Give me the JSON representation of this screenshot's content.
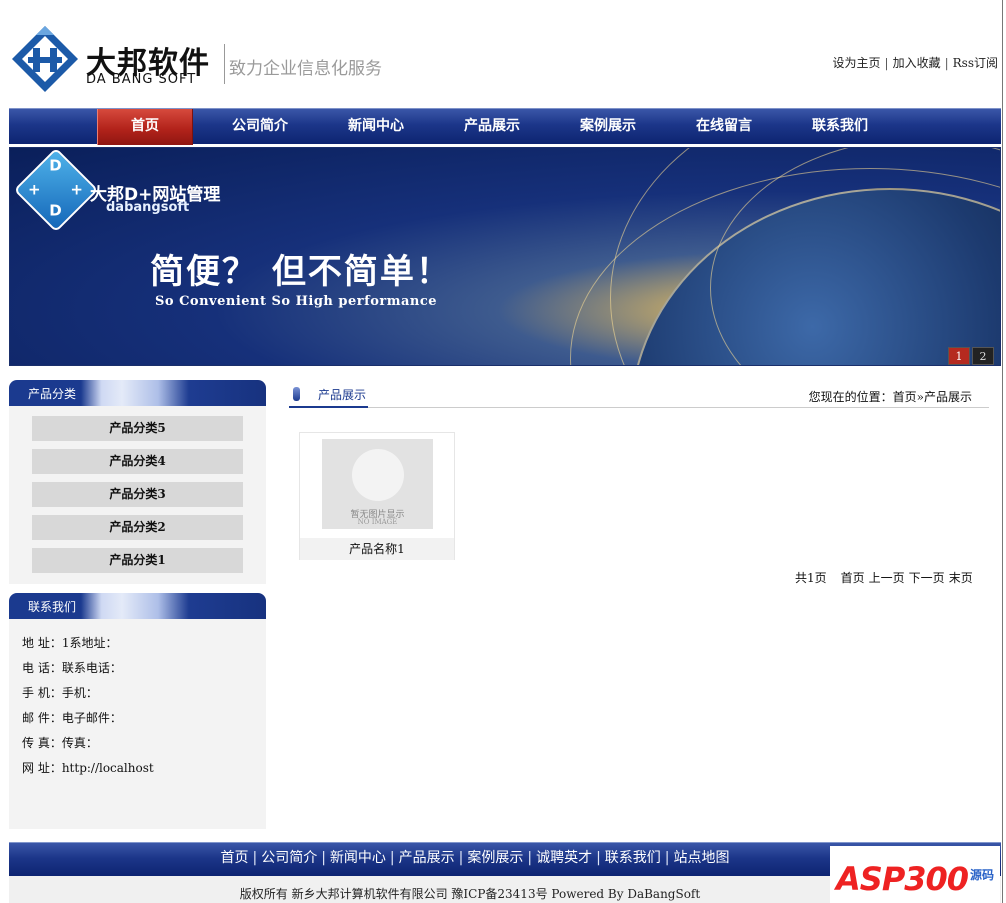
{
  "header": {
    "logo_cn": "大邦软件",
    "logo_en": "DA BANG SOFT",
    "slogan": "致力企业信息化服务",
    "toplinks": [
      "设为主页",
      "加入收藏",
      "Rss订阅"
    ]
  },
  "nav": {
    "items": [
      "首页",
      "公司简介",
      "新闻中心",
      "产品展示",
      "案例展示",
      "在线留言",
      "联系我们"
    ],
    "active": "首页"
  },
  "banner": {
    "brand": "大邦D+网站管理",
    "brand_sub": "dabangsoft",
    "cube_letters": [
      "D",
      "+",
      "D",
      "+"
    ],
    "headline": "简便？ 但不简单！",
    "tagline": "So Convenient  So High performance",
    "slides": [
      "1",
      "2"
    ]
  },
  "sidebar": {
    "categories_title": "产品分类",
    "categories": [
      "产品分类5",
      "产品分类4",
      "产品分类3",
      "产品分类2",
      "产品分类1"
    ],
    "contact_title": "联系我们",
    "contact": [
      "地 址：1系地址：",
      "电 话：联系电话：",
      "手 机：手机：",
      "邮 件：电子邮件：",
      "传 真：传真：",
      "网 址：http://localhost"
    ]
  },
  "main": {
    "tab_label": "产品展示",
    "breadcrumb": "您现在的位置：首页»产品展示",
    "products": [
      {
        "name": "产品名称1",
        "placeholder_cn": "暂无图片显示",
        "placeholder_en": "NO IMAGE"
      }
    ],
    "pager": {
      "total": "共1页",
      "first": "首页",
      "prev": "上一页",
      "next": "下一页",
      "last": "末页"
    }
  },
  "footer": {
    "links": [
      "首页",
      "公司简介",
      "新闻中心",
      "产品展示",
      "案例展示",
      "诚聘英才",
      "联系我们",
      "站点地图"
    ],
    "copyright": "版权所有 新乡大邦计算机软件有限公司   豫ICP备23413号   Powered By DaBangSoft",
    "watermark": "ASP300",
    "watermark_side": "源码"
  }
}
